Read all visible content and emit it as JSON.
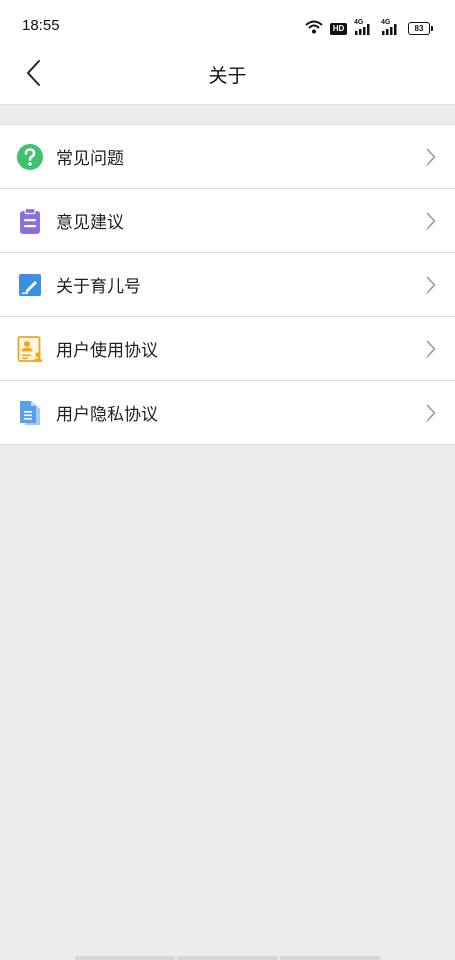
{
  "status_bar": {
    "time": "18:55",
    "hd_label": "HD",
    "signal_1_label": "4G",
    "signal_2_label": "4G",
    "battery": "83"
  },
  "nav": {
    "title": "关于"
  },
  "menu": {
    "items": [
      {
        "label": "常见问题",
        "icon": "question-icon",
        "color": "#3dc26f"
      },
      {
        "label": "意见建议",
        "icon": "clipboard-icon",
        "color": "#8a6fe0"
      },
      {
        "label": "关于育儿号",
        "icon": "edit-icon",
        "color": "#3d8fe6"
      },
      {
        "label": "用户使用协议",
        "icon": "user-card-icon",
        "color": "#f3a51f"
      },
      {
        "label": "用户隐私协议",
        "icon": "document-icon",
        "color": "#5aa0e8"
      }
    ]
  }
}
